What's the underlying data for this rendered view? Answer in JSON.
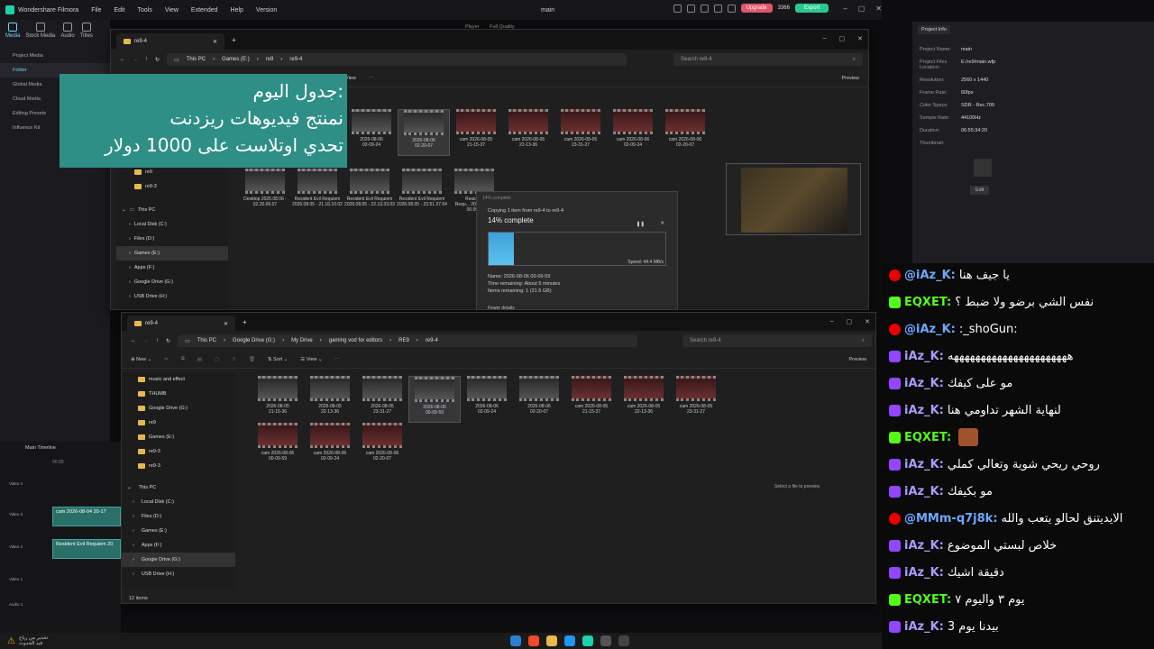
{
  "filmora": {
    "app_name": "Wondershare Filmora",
    "menu": [
      "File",
      "Edit",
      "Tools",
      "View",
      "Extended",
      "Help",
      "Version"
    ],
    "project_title": "main",
    "upgrade_label": "Upgrade",
    "credits": "3366",
    "export_label": "Export",
    "toolbar": [
      "Media",
      "Stock Media",
      "Audio",
      "Titles"
    ],
    "sidebar": [
      "Project Media",
      "Folder",
      "Global Media",
      "Cloud Media",
      "Editing Presets",
      "Influence Kit"
    ],
    "player_label": "Player",
    "player_quality": "Full Quality",
    "project_info": {
      "tab": "Project Info",
      "rows": [
        {
          "k": "Project Name:",
          "v": "main"
        },
        {
          "k": "Project Files Location:",
          "v": "E:/re9/main.wfp"
        },
        {
          "k": "Resolution:",
          "v": "2560 x 1440"
        },
        {
          "k": "Frame Rate:",
          "v": "60fps"
        },
        {
          "k": "Color Space:",
          "v": "SDR - Rec.709"
        },
        {
          "k": "Sample Rate:",
          "v": "44100Hz"
        },
        {
          "k": "Duration:",
          "v": "06:55:34:20"
        },
        {
          "k": "Thumbnail:",
          "v": ""
        }
      ],
      "edit_label": "Edit"
    },
    "timeline": {
      "title": "Main Timeline",
      "ruler": "00:00",
      "tracks": [
        "Video 4",
        "Video 3",
        "Video 2",
        "Video 1",
        "Audio 1"
      ],
      "clip1": "cam 2026-08-04 20-17",
      "clip2": "Resident Evil Requiem 20"
    }
  },
  "overlay": {
    "line1": "جدول اليوم:",
    "line2": "نمنتج فيديوهات ريزدنت",
    "line3": "تحدي اوتلاست على 1000 دولار"
  },
  "explorer1": {
    "tab": "re9-4",
    "path": [
      "This PC",
      "Games (E:)",
      "re9",
      "re9-4"
    ],
    "search": "Search re9-4",
    "view_label": "View",
    "preview_label": "Preview",
    "nav": [
      "re9",
      "re9-3",
      "This PC",
      "Local Disk (C:)",
      "Files (D:)",
      "Games (E:)",
      "Apps (F:)",
      "Google Drive (G:)",
      "USB Drive (H:)"
    ],
    "row1": [
      {
        "n": "2026-08-06",
        "s": "02-09-24"
      },
      {
        "n": "2026-08-06",
        "s": "02-20-07"
      },
      {
        "n": "cam 2026-08-05",
        "s": "21-15-37"
      },
      {
        "n": "cam 2026-08-05",
        "s": "22-13-36"
      },
      {
        "n": "cam 2026-08-05",
        "s": "23-31-27"
      },
      {
        "n": "cam 2026-08-06",
        "s": "02-09-24"
      },
      {
        "n": "cam 2026-08-06",
        "s": "02-20-07"
      }
    ],
    "row2": [
      {
        "n": "Desktop 2026.08.06 -",
        "s": "02.20.06.07"
      },
      {
        "n": "Resident Evil Requiem",
        "s": "2026.08.05 - 21.16.10.02"
      },
      {
        "n": "Resident Evil Requiem",
        "s": "2026.08.05 - 22.13.33.03"
      },
      {
        "n": "Resident Evil Requiem",
        "s": "2026.08.05 - 23.51.37.04"
      },
      {
        "n": "Resident",
        "s": "Requ... 2026.08.06 00.09.5"
      }
    ]
  },
  "copy_dialog": {
    "title": "14% complete",
    "subtitle": "Copying 1 item from re9-4 to re9-4",
    "headline": "14% complete",
    "progress": 0.14,
    "speed": "Speed: 44.4 MB/s",
    "name_line": "Name: 2026-08-06 00-09-59",
    "time_line": "Time remaining: About 5 minutes",
    "items_line": "Items remaining: 1 (21.5 GB)",
    "fewer": "Fewer details"
  },
  "explorer2": {
    "tab": "re9-4",
    "path": [
      "This PC",
      "Google Drive (G:)",
      "My Drive",
      "gaming vod for editors",
      "RE9",
      "re9-4"
    ],
    "search": "Search re9-4",
    "new_label": "New",
    "sort_label": "Sort",
    "view_label": "View",
    "preview_label": "Preview",
    "nav": [
      "music and effect",
      "THUMB",
      "Google Drive (G:)",
      "re9",
      "Games (E:)",
      "re9-3",
      "re9-3",
      "This PC",
      "Local Disk (C:)",
      "Files (D:)",
      "Games (E:)",
      "Apps (F:)",
      "Google Drive (G:)",
      "USB Drive (H:)"
    ],
    "row1": [
      {
        "n": "2026-08-05",
        "s": "21-15-36"
      },
      {
        "n": "2026-08-05",
        "s": "22-13-36"
      },
      {
        "n": "2026-08-05",
        "s": "23-31-27"
      },
      {
        "n": "2026-08-06",
        "s": "00-09-59"
      },
      {
        "n": "2026-08-06",
        "s": "02-09-24"
      },
      {
        "n": "2026-08-06",
        "s": "02-20-07"
      },
      {
        "n": "cam 2026-08-05",
        "s": "21-15-37"
      },
      {
        "n": "cam 2026-08-05",
        "s": "22-13-36"
      },
      {
        "n": "cam 2026-08-05",
        "s": "23-31-27"
      }
    ],
    "row2": [
      {
        "n": "cam 2026-08-06",
        "s": "00-09-59"
      },
      {
        "n": "cam 2026-08-06",
        "s": "02-09-24"
      },
      {
        "n": "cam 2026-08-06",
        "s": "02-20-07"
      }
    ],
    "preview_hint": "Select a file to preview.",
    "status": "12 items"
  },
  "chat": [
    {
      "p": "yt",
      "u": "@iAz_K",
      "m": "يا جيف هنا"
    },
    {
      "p": "kk",
      "u": "EQXET",
      "m": "نفس الشي برضو ولا ضبط ؟"
    },
    {
      "p": "yt",
      "u": "@iAz_K",
      "m": ":_shoGun:"
    },
    {
      "p": "tw",
      "u": "iAz_K",
      "m": "ههههههههههههههههههههههه"
    },
    {
      "p": "tw",
      "u": "iAz_K",
      "m": "مو على كيفك"
    },
    {
      "p": "tw",
      "u": "iAz_K",
      "m": "لنهاية الشهر تداومي هنا"
    },
    {
      "p": "kk",
      "u": "EQXET",
      "m": ""
    },
    {
      "p": "tw",
      "u": "iAz_K",
      "m": "روحي ريحي شوية وتعالي كملي"
    },
    {
      "p": "tw",
      "u": "iAz_K",
      "m": "مو بكيفك"
    },
    {
      "p": "yt",
      "u": "@MMm-q7j8k",
      "m": "الايديتنق لحالو يتعب والله"
    },
    {
      "p": "tw",
      "u": "iAz_K",
      "m": "خلاص لبستي الموضوع"
    },
    {
      "p": "tw",
      "u": "iAz_K",
      "m": "دقيقة اشيك"
    },
    {
      "p": "kk",
      "u": "EQXET",
      "m": "يوم ٣ واليوم ٧"
    },
    {
      "p": "tw",
      "u": "iAz_K",
      "m": "بيدنا يوم 3"
    }
  ],
  "taskbar": {
    "warn_line1": "تحذير من رياح",
    "warn_line2": "قيد الحدوث"
  }
}
